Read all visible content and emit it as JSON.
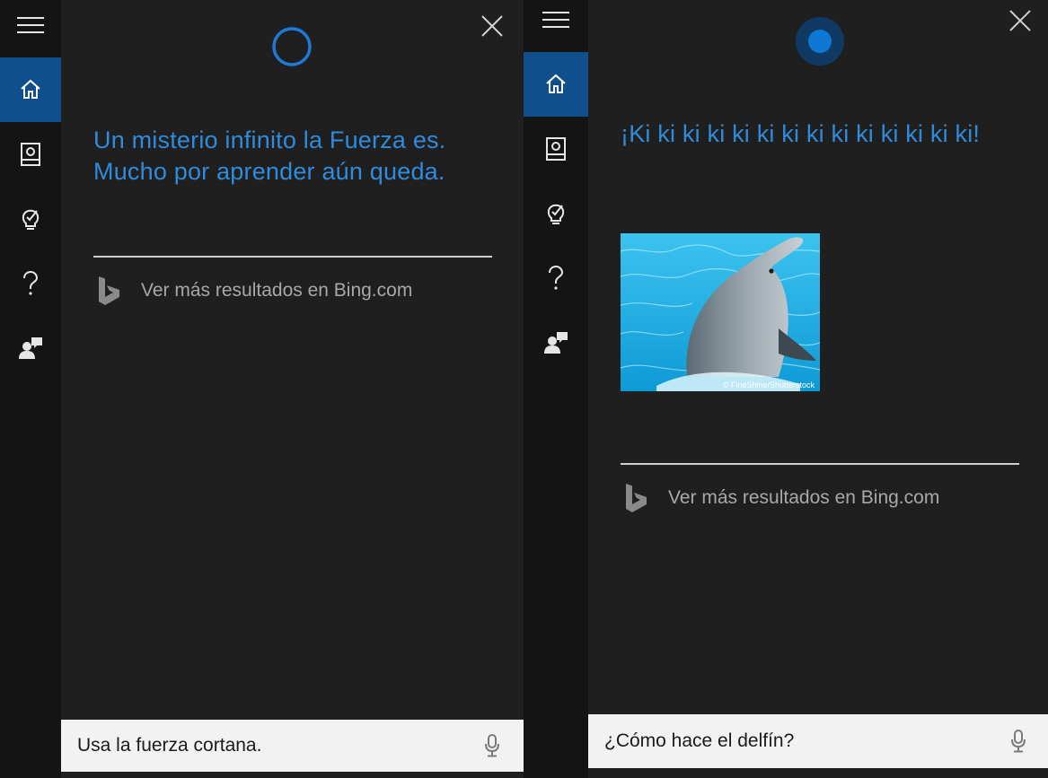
{
  "panels": [
    {
      "answer": "Un misterio infinito la Fuerza es. Mucho por aprender aún queda.",
      "bing_link": "Ver más resultados en Bing.com",
      "query": "Usa la fuerza cortana.",
      "cortana_state": "listening-ring"
    },
    {
      "answer": "¡Ki ki ki ki ki ki ki ki ki ki ki ki ki ki!",
      "image_credit": "© FineShine/Shutterstock",
      "bing_link": "Ver más resultados en Bing.com",
      "query": "¿Cómo hace el delfín?",
      "cortana_state": "speaking-dot"
    }
  ],
  "sidebar_icons": [
    "hamburger-menu-icon",
    "home-icon",
    "notebook-icon",
    "lightbulb-icon",
    "help-icon",
    "feedback-icon"
  ],
  "colors": {
    "accent": "#2f8bdb",
    "active_rail": "#0e4f8c",
    "background": "#1f1f1f",
    "rail_background": "#141414",
    "search_bar": "#f2f2f2"
  }
}
